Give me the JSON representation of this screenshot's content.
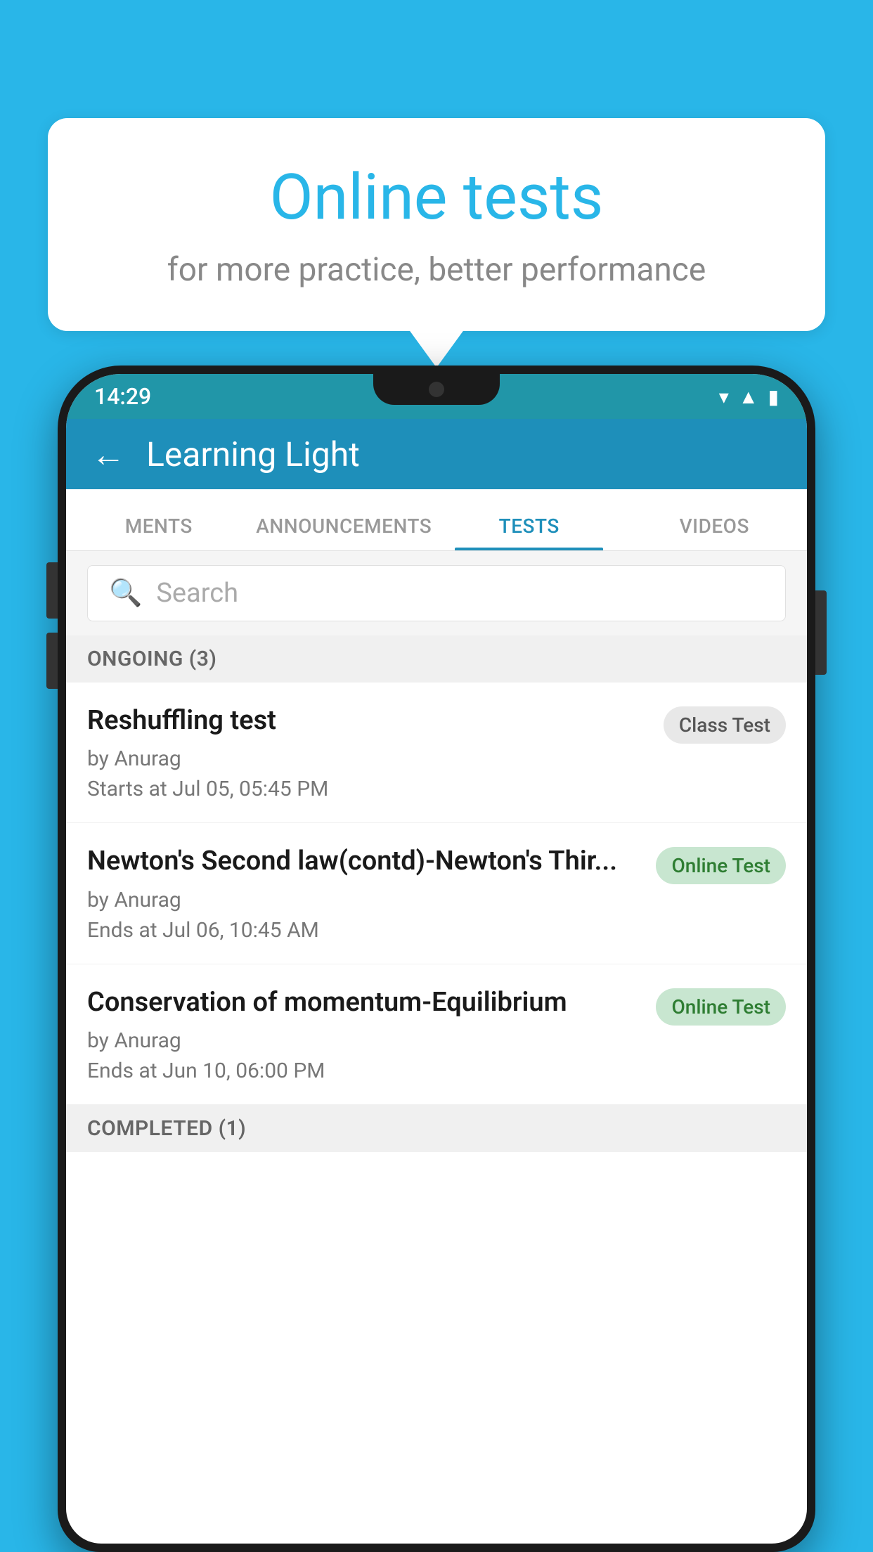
{
  "background": {
    "color": "#29b6e8"
  },
  "speechBubble": {
    "title": "Online tests",
    "subtitle": "for more practice, better performance"
  },
  "phone": {
    "statusBar": {
      "time": "14:29",
      "icons": [
        "wifi",
        "signal",
        "battery"
      ]
    },
    "header": {
      "title": "Learning Light",
      "backLabel": "←"
    },
    "tabs": [
      {
        "label": "MENTS",
        "active": false
      },
      {
        "label": "ANNOUNCEMENTS",
        "active": false
      },
      {
        "label": "TESTS",
        "active": true
      },
      {
        "label": "VIDEOS",
        "active": false
      }
    ],
    "search": {
      "placeholder": "Search"
    },
    "sections": [
      {
        "header": "ONGOING (3)",
        "tests": [
          {
            "title": "Reshuffling test",
            "author": "by Anurag",
            "date": "Starts at  Jul 05, 05:45 PM",
            "badge": "Class Test",
            "badgeType": "class"
          },
          {
            "title": "Newton's Second law(contd)-Newton's Thir...",
            "author": "by Anurag",
            "date": "Ends at  Jul 06, 10:45 AM",
            "badge": "Online Test",
            "badgeType": "online"
          },
          {
            "title": "Conservation of momentum-Equilibrium",
            "author": "by Anurag",
            "date": "Ends at  Jun 10, 06:00 PM",
            "badge": "Online Test",
            "badgeType": "online"
          }
        ]
      }
    ],
    "completedSection": {
      "header": "COMPLETED (1)"
    }
  }
}
